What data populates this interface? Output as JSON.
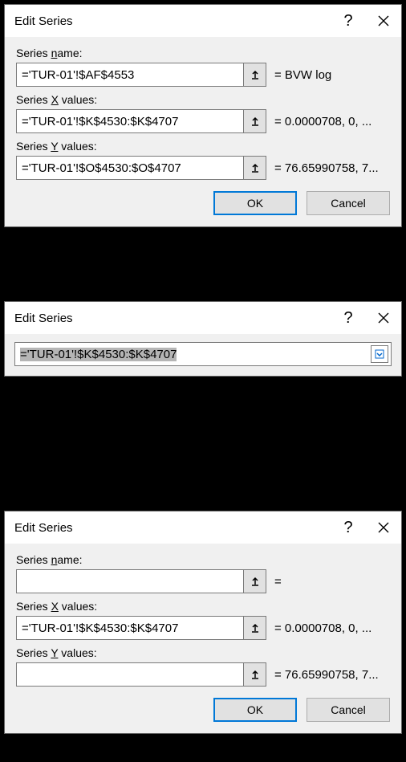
{
  "dialog1": {
    "title": "Edit Series",
    "series_name_label_pre": "Series ",
    "series_name_label_ul": "n",
    "series_name_label_post": "ame:",
    "series_name_value": "='TUR-01'!$AF$4553",
    "series_name_preview": "=  BVW log",
    "series_x_label_pre": "Series ",
    "series_x_label_ul": "X",
    "series_x_label_post": " values:",
    "series_x_value": "='TUR-01'!$K$4530:$K$4707",
    "series_x_preview": "=  0.0000708, 0, ...",
    "series_y_label_pre": "Series ",
    "series_y_label_ul": "Y",
    "series_y_label_post": " values:",
    "series_y_value": "='TUR-01'!$O$4530:$O$4707",
    "series_y_preview": "=  76.65990758, 7...",
    "ok": "OK",
    "cancel": "Cancel"
  },
  "dialog2": {
    "title": "Edit Series",
    "value": "='TUR-01'!$K$4530:$K$4707"
  },
  "dialog3": {
    "title": "Edit Series",
    "series_name_label_pre": "Series ",
    "series_name_label_ul": "n",
    "series_name_label_post": "ame:",
    "series_name_value": "",
    "series_name_preview": "=",
    "series_x_label_pre": "Series ",
    "series_x_label_ul": "X",
    "series_x_label_post": " values:",
    "series_x_value": "='TUR-01'!$K$4530:$K$4707",
    "series_x_preview": "=  0.0000708, 0, ...",
    "series_y_label_pre": "Series ",
    "series_y_label_ul": "Y",
    "series_y_label_post": " values:",
    "series_y_value": "",
    "series_y_preview": "=  76.65990758, 7...",
    "ok": "OK",
    "cancel": "Cancel"
  }
}
